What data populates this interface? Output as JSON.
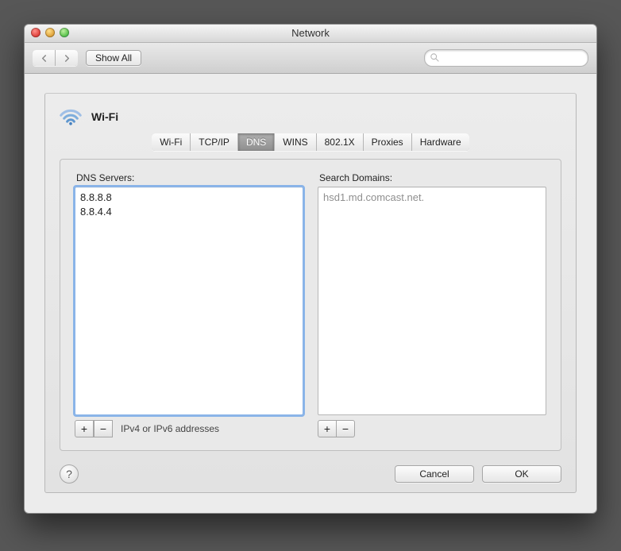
{
  "window": {
    "title": "Network"
  },
  "toolbar": {
    "show_all": "Show All",
    "search_placeholder": ""
  },
  "header": {
    "interface": "Wi-Fi"
  },
  "tabs": [
    {
      "label": "Wi-Fi",
      "active": false
    },
    {
      "label": "TCP/IP",
      "active": false
    },
    {
      "label": "DNS",
      "active": true
    },
    {
      "label": "WINS",
      "active": false
    },
    {
      "label": "802.1X",
      "active": false
    },
    {
      "label": "Proxies",
      "active": false
    },
    {
      "label": "Hardware",
      "active": false
    }
  ],
  "panel": {
    "dns_label": "DNS Servers:",
    "dns_servers": [
      "8.8.8.8",
      "8.8.4.4"
    ],
    "search_label": "Search Domains:",
    "search_domains": [
      "hsd1.md.comcast.net."
    ],
    "hint": "IPv4 or IPv6 addresses",
    "add": "+",
    "remove": "−"
  },
  "footer": {
    "cancel": "Cancel",
    "ok": "OK"
  }
}
